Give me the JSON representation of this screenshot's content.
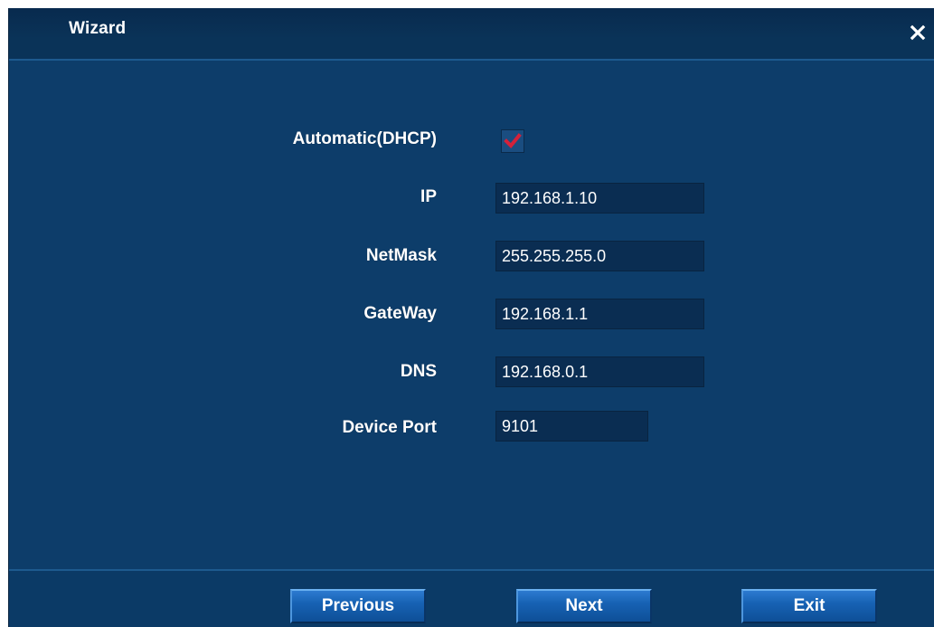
{
  "window": {
    "title": "Wizard"
  },
  "network": {
    "dhcp_label": "Automatic(DHCP)",
    "dhcp_checked": true,
    "fields": [
      {
        "label": "IP",
        "value": "192.168.1.10"
      },
      {
        "label": "NetMask",
        "value": "255.255.255.0"
      },
      {
        "label": "GateWay",
        "value": "192.168.1.1"
      },
      {
        "label": "DNS",
        "value": "192.168.0.1"
      },
      {
        "label": "Device Port",
        "value": "9101"
      }
    ]
  },
  "footer": {
    "previous_label": "Previous",
    "next_label": "Next",
    "exit_label": "Exit"
  },
  "colors": {
    "panel_bg": "#0d3d6a",
    "titlebar_bg": "#0a3358",
    "field_bg": "#0a2d52",
    "button_bg": "#1762b4",
    "check_mark": "#d4213a"
  },
  "icons": {
    "close": "close-icon",
    "check": "checkmark-icon"
  }
}
